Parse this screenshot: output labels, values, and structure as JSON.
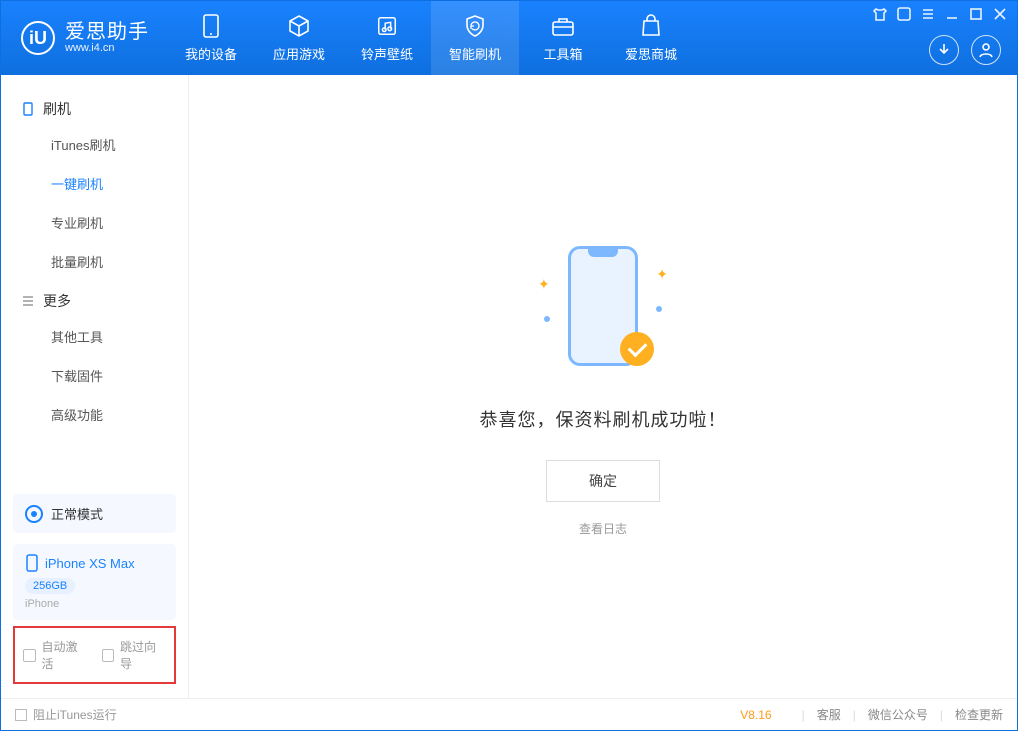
{
  "app": {
    "title": "爱思助手",
    "site": "www.i4.cn"
  },
  "nav": {
    "items": [
      {
        "label": "我的设备"
      },
      {
        "label": "应用游戏"
      },
      {
        "label": "铃声壁纸"
      },
      {
        "label": "智能刷机"
      },
      {
        "label": "工具箱"
      },
      {
        "label": "爱思商城"
      }
    ]
  },
  "sidebar": {
    "group_flash": "刷机",
    "group_more": "更多",
    "flash_items": [
      {
        "label": "iTunes刷机"
      },
      {
        "label": "一键刷机"
      },
      {
        "label": "专业刷机"
      },
      {
        "label": "批量刷机"
      }
    ],
    "more_items": [
      {
        "label": "其他工具"
      },
      {
        "label": "下载固件"
      },
      {
        "label": "高级功能"
      }
    ],
    "mode_label": "正常模式",
    "device": {
      "name": "iPhone XS Max",
      "capacity": "256GB",
      "type": "iPhone"
    },
    "check_auto_activate": "自动激活",
    "check_skip_guide": "跳过向导"
  },
  "main": {
    "success_text": "恭喜您，保资料刷机成功啦！",
    "ok_btn": "确定",
    "view_log": "查看日志"
  },
  "footer": {
    "block_itunes": "阻止iTunes运行",
    "version": "V8.16",
    "links": [
      "客服",
      "微信公众号",
      "检查更新"
    ]
  }
}
